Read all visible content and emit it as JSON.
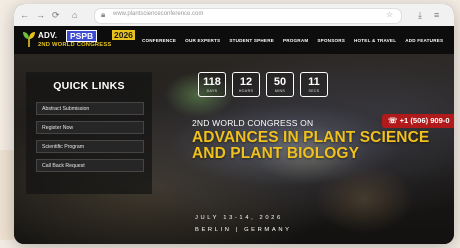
{
  "browser": {
    "url": "www.plantscienceconference.com"
  },
  "logo": {
    "adv": "ADV.",
    "badge": "PSPB",
    "year": "2026",
    "subtitle": "2ND WORLD CONGRESS"
  },
  "nav": {
    "items": [
      "CONFERENCE",
      "OUR EXPERTS",
      "STUDENT SPHERE",
      "PROGRAM",
      "SPONSORS",
      "HOTEL & TRAVEL",
      "ADD FEATURES"
    ]
  },
  "quick_links": {
    "title": "QUICK LINKS",
    "items": [
      "Abstract Submission",
      "Register Now",
      "Scientific Program",
      "Call Back Request"
    ]
  },
  "countdown": [
    {
      "value": "118",
      "unit": "DAYS"
    },
    {
      "value": "12",
      "unit": "HOURS"
    },
    {
      "value": "50",
      "unit": "MINS"
    },
    {
      "value": "11",
      "unit": "SECS"
    }
  ],
  "hero": {
    "kicker": "2ND WORLD CONGRESS ON",
    "headline": "ADVANCES IN PLANT SCIENCE AND PLANT BIOLOGY",
    "dates": "JULY 13-14, 2026",
    "location": "BERLIN | GERMANY"
  },
  "contact": {
    "phone": "☏ +1 (506) 909-0"
  },
  "colors": {
    "accent_yellow": "#f0c11c",
    "badge_blue": "#3d4bd1",
    "phone_red": "#b11a1a"
  }
}
